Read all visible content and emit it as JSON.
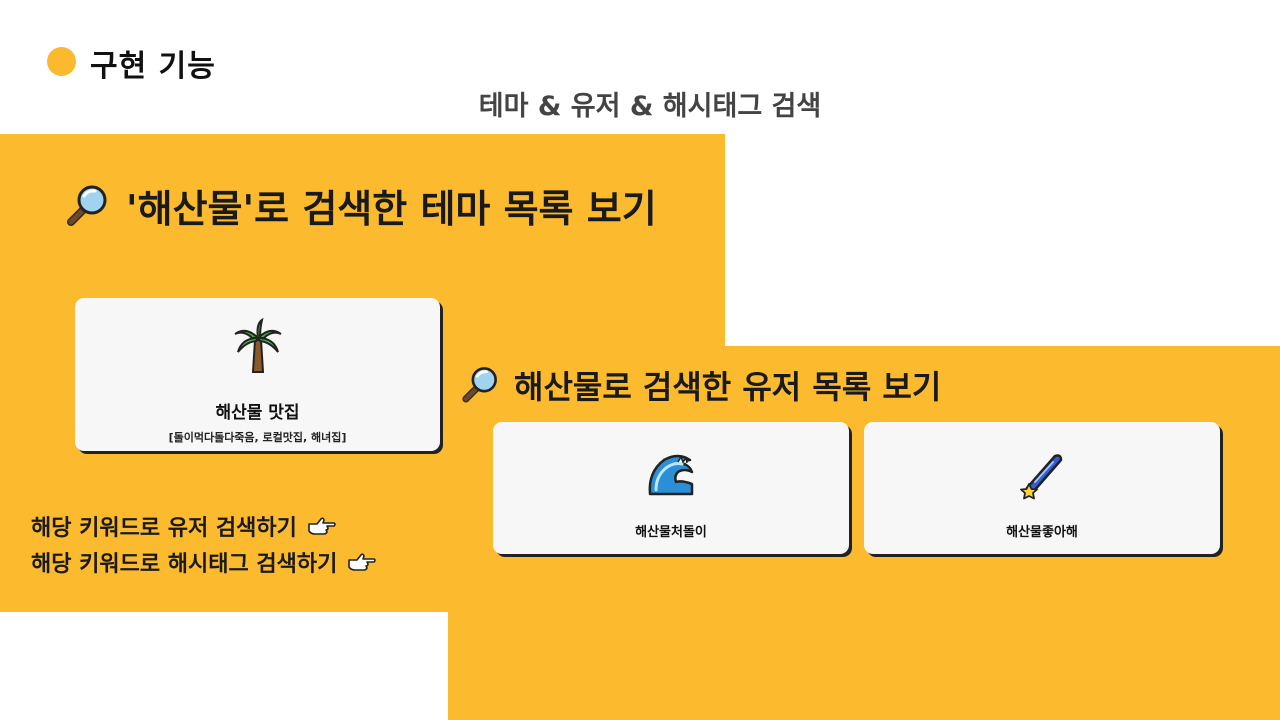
{
  "header": {
    "title": "구현 기능",
    "subtitle": "테마 & 유저 & 해시태그 검색"
  },
  "theme_section": {
    "heading": "'해산물'로 검색한 테마 목록 보기",
    "icon": "magnifier-icon",
    "card": {
      "icon": "palm-tree-icon",
      "title": "해산물 맛집",
      "description": "[돌이먹다돌다죽음, 로컬맛집, 해녀집]"
    },
    "links": [
      {
        "label": "해당 키워드로 유저 검색하기",
        "icon": "pointing-hand-icon"
      },
      {
        "label": "해당 키워드로 해시태그 검색하기",
        "icon": "pointing-hand-icon"
      }
    ]
  },
  "user_section": {
    "heading": "해산물로 검색한 유저 목록 보기",
    "icon": "magnifier-icon",
    "cards": [
      {
        "icon": "wave-icon",
        "name": "해산물처돌이"
      },
      {
        "icon": "shooting-star-icon",
        "name": "해산물좋아해"
      }
    ]
  },
  "colors": {
    "accent": "#FCBA2F",
    "card_bg": "#F7F7F7",
    "text": "#1a1a1a"
  }
}
